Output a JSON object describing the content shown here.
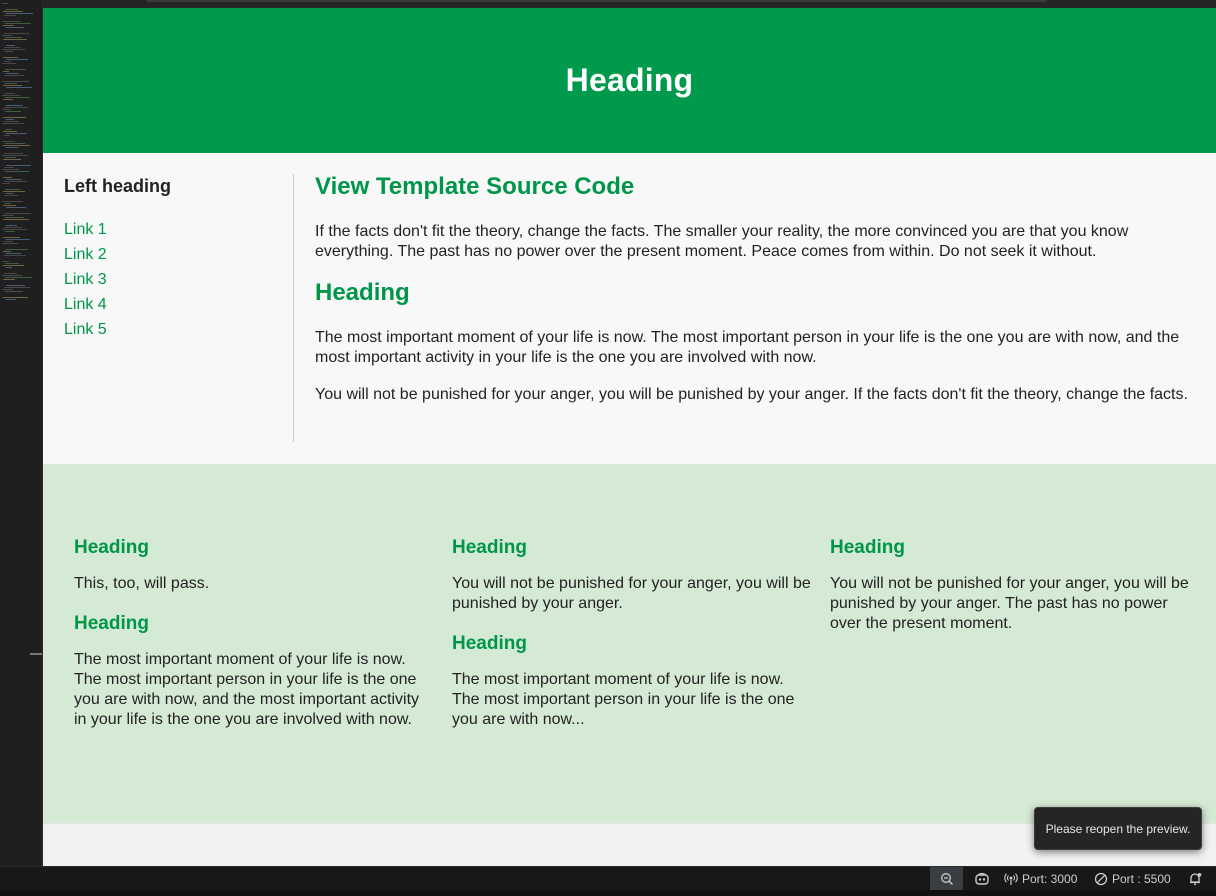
{
  "preview": {
    "hero_title": "Heading",
    "sidebar": {
      "heading": "Left heading",
      "links": [
        "Link 1",
        "Link 2",
        "Link 3",
        "Link 4",
        "Link 5"
      ]
    },
    "content": {
      "title": "View Template Source Code",
      "intro": "If the facts don't fit the theory, change the facts. The smaller your reality, the more convinced you are that you know everything. The past has no power over the present moment. Peace comes from within. Do not seek it without.",
      "subheading": "Heading",
      "para1": "The most important moment of your life is now. The most important person in your life is the one you are with now, and the most important activity in your life is the one you are involved with now.",
      "para2": "You will not be punished for your anger, you will be punished by your anger. If the facts don't fit the theory, change the facts."
    },
    "columns": [
      {
        "h1": "Heading",
        "p1": "This, too, will pass.",
        "h2": "Heading",
        "p2": "The most important moment of your life is now. The most important person in your life is the one you are with now, and the most important activity in your life is the one you are involved with now."
      },
      {
        "h1": "Heading",
        "p1": "You will not be punished for your anger, you will be punished by your anger.",
        "h2": "Heading",
        "p2": "The most important moment of your life is now. The most important person in your life is the one you are with now..."
      },
      {
        "h1": "Heading",
        "p1": "You will not be punished for your anger, you will be punished by your anger. The past has no power over the present moment."
      }
    ],
    "colors": {
      "brand_green": "#009a4c",
      "link_green": "#00964a",
      "band_bg": "#d5ead5"
    }
  },
  "toast": {
    "message": "Please reopen the preview."
  },
  "statusbar": {
    "zoom_icon": "zoom-out-icon",
    "copilot_icon": "copilot-icon",
    "port_a": "Port: 3000",
    "port_b": "Port : 5500",
    "bell_icon": "bell-icon"
  }
}
